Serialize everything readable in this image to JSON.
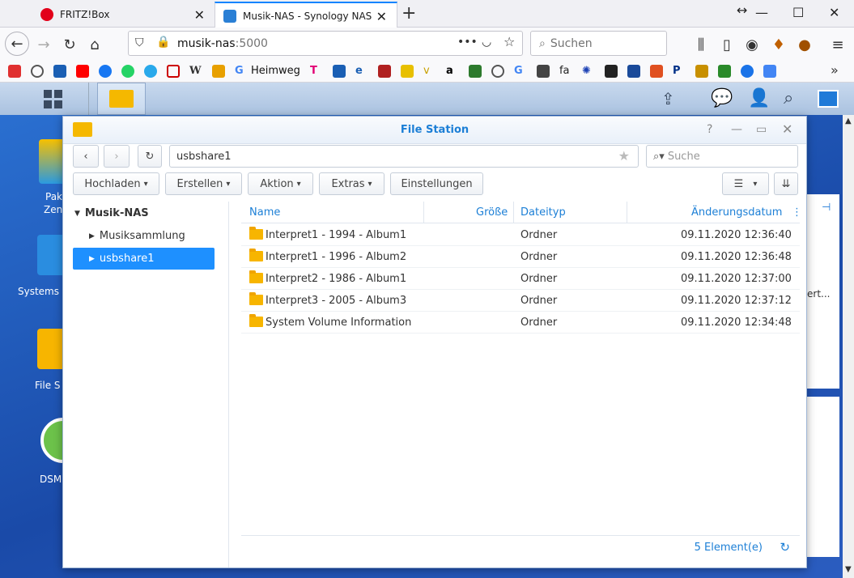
{
  "browser": {
    "tabs": [
      {
        "label": "FRITZ!Box",
        "active": false
      },
      {
        "label": "Musik-NAS - Synology NAS",
        "active": true
      }
    ],
    "url_host": "musik-nas",
    "url_port": ":5000",
    "search_placeholder": "Suchen",
    "bookmark_heimweg": "Heimweg"
  },
  "dsm": {
    "desktop_icons": [
      "Pak",
      "Zen",
      "Systems",
      "File S",
      "DSM"
    ],
    "background_text": "ert..."
  },
  "filestation": {
    "title": "File Station",
    "path": "usbshare1",
    "search_placeholder": "Suche",
    "toolbar": {
      "upload": "Hochladen",
      "create": "Erstellen",
      "action": "Aktion",
      "extras": "Extras",
      "settings": "Einstellungen"
    },
    "tree": {
      "root": "Musik-NAS",
      "items": [
        "Musiksammlung",
        "usbshare1"
      ]
    },
    "columns": {
      "name": "Name",
      "size": "Größe",
      "type": "Dateityp",
      "modified": "Änderungsdatum"
    },
    "rows": [
      {
        "name": "Interpret1 - 1994 - Album1",
        "type": "Ordner",
        "modified": "09.11.2020 12:36:40"
      },
      {
        "name": "Interpret1 - 1996 - Album2",
        "type": "Ordner",
        "modified": "09.11.2020 12:36:48"
      },
      {
        "name": "Interpret2 - 1986 - Album1",
        "type": "Ordner",
        "modified": "09.11.2020 12:37:00"
      },
      {
        "name": "Interpret3 - 2005 - Album3",
        "type": "Ordner",
        "modified": "09.11.2020 12:37:12"
      },
      {
        "name": "System Volume Information",
        "type": "Ordner",
        "modified": "09.11.2020 12:34:48"
      }
    ],
    "status": "5 Element(e)"
  }
}
